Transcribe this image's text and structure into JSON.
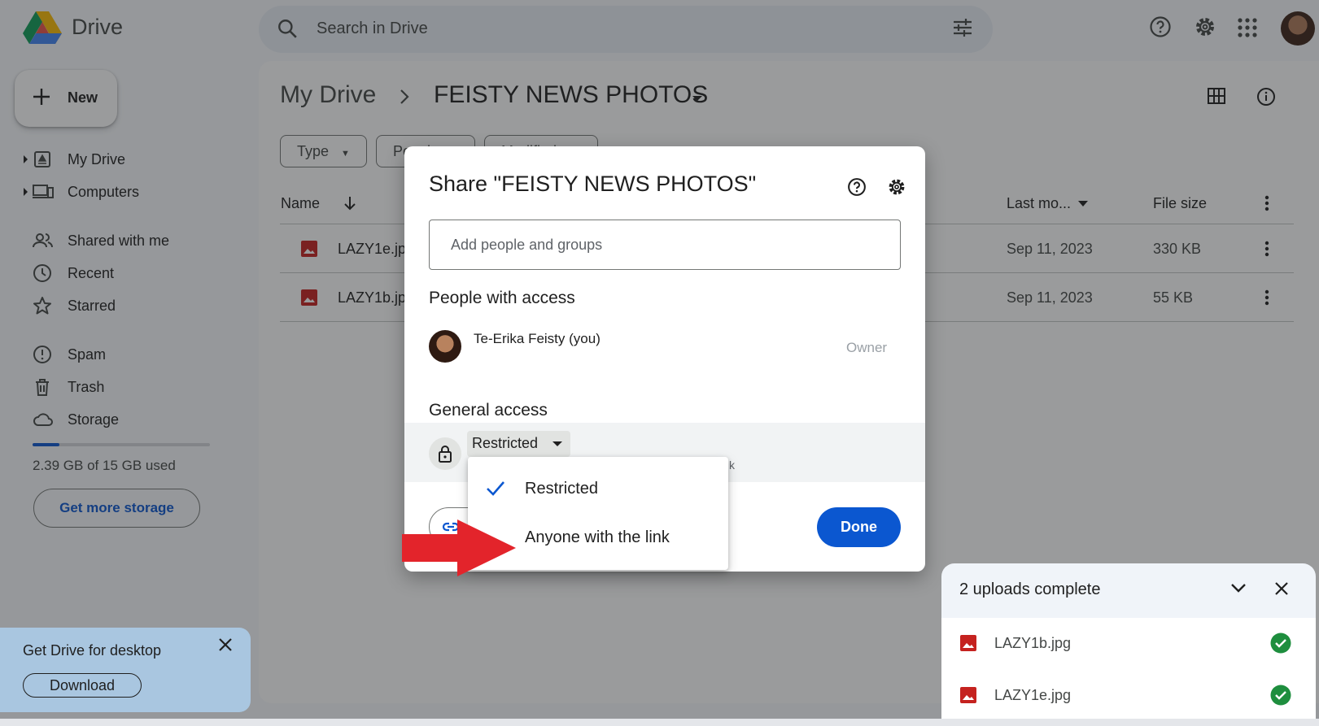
{
  "header": {
    "app_name": "Drive",
    "search_placeholder": "Search in Drive"
  },
  "sidebar": {
    "new_label": "New",
    "items": [
      {
        "label": "My Drive",
        "icon": "my-drive-icon"
      },
      {
        "label": "Computers",
        "icon": "computers-icon"
      },
      {
        "label": "Shared with me",
        "icon": "shared-icon"
      },
      {
        "label": "Recent",
        "icon": "clock-icon"
      },
      {
        "label": "Starred",
        "icon": "star-icon"
      },
      {
        "label": "Spam",
        "icon": "spam-icon"
      },
      {
        "label": "Trash",
        "icon": "trash-icon"
      },
      {
        "label": "Storage",
        "icon": "cloud-icon"
      }
    ],
    "storage_used_fraction": 0.16,
    "storage_text": "2.39 GB of 15 GB used",
    "get_more_storage": "Get more storage"
  },
  "breadcrumb": {
    "root": "My Drive",
    "current": "FEISTY NEWS PHOTOS"
  },
  "filters": [
    "Type",
    "People",
    "Modified"
  ],
  "table": {
    "headers": {
      "name": "Name",
      "modified": "Last mo...",
      "size": "File size"
    },
    "rows": [
      {
        "name": "LAZY1e.jpg",
        "modified": "Sep 11, 2023",
        "size": "330 KB"
      },
      {
        "name": "LAZY1b.jpg",
        "modified": "Sep 11, 2023",
        "size": "55 KB"
      }
    ]
  },
  "share_dialog": {
    "title": "Share \"FEISTY NEWS PHOTOS\"",
    "add_placeholder": "Add people and groups",
    "people_title": "People with access",
    "person_name": "Te-Erika Feisty (you)",
    "person_role": "Owner",
    "general_title": "General access",
    "access_value": "Restricted",
    "access_hint_tail": "k",
    "done_label": "Done",
    "menu_options": [
      {
        "label": "Restricted",
        "selected": true
      },
      {
        "label": "Anyone with the link",
        "selected": false
      }
    ]
  },
  "promo": {
    "title": "Get Drive for desktop",
    "download_label": "Download"
  },
  "uploads": {
    "title": "2 uploads complete",
    "files": [
      "LAZY1b.jpg",
      "LAZY1e.jpg"
    ]
  },
  "colors": {
    "accent": "#0b57d0",
    "scrim": "#202124",
    "arrow": "#e3242b",
    "success": "#1e8e3e",
    "file_icon": "#c5221f"
  }
}
